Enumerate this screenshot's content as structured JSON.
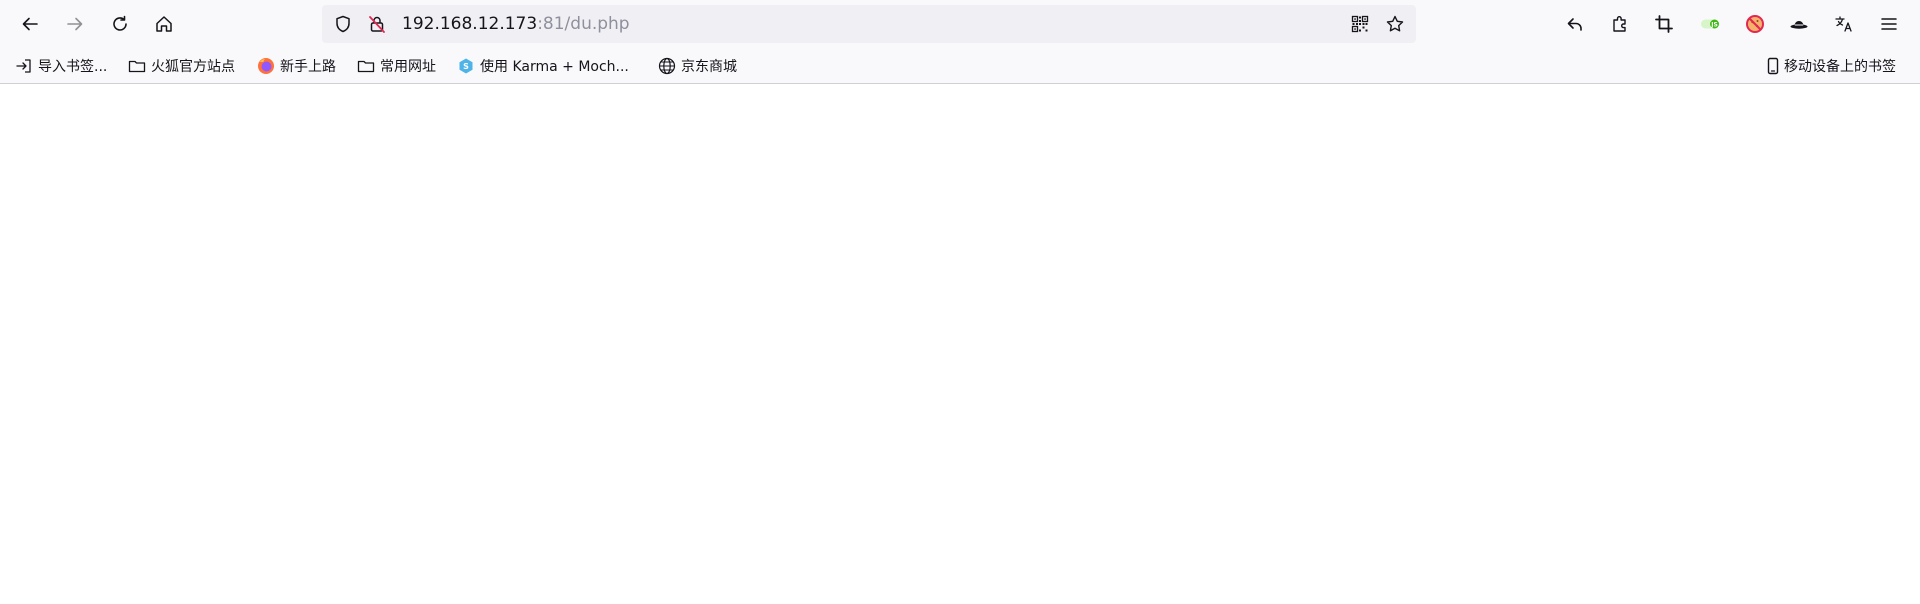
{
  "toolbar": {
    "back_icon": "arrow-left-icon",
    "forward_icon": "arrow-right-icon",
    "reload_icon": "reload-icon",
    "home_icon": "home-icon"
  },
  "urlbar": {
    "host": "192.168.12.173",
    "rest": ":81/du.php",
    "icons": [
      "shield-icon",
      "insecure-lock-icon",
      "qr-code-icon",
      "star-icon"
    ]
  },
  "extensions": {
    "icons": [
      "undo-icon",
      "extensions-puzzle-icon",
      "crop-icon",
      "js-toggle-icon",
      "no-cookie-icon",
      "hat-icon",
      "translate-icon",
      "hamburger-menu-icon"
    ]
  },
  "bookmarks": {
    "items": [
      {
        "label": "导入书签...",
        "icon": "import-icon"
      },
      {
        "label": "火狐官方站点",
        "icon": "folder-icon"
      },
      {
        "label": "新手上路",
        "icon": "firefox-icon"
      },
      {
        "label": "常用网址",
        "icon": "folder-icon"
      },
      {
        "label": "使用 Karma + Moch...",
        "icon": "karma-icon"
      },
      {
        "label": "京东商城",
        "icon": "globe-icon"
      }
    ],
    "mobile": {
      "label": "移动设备上的书签",
      "icon": "mobile-icon"
    }
  },
  "colors": {
    "toolbar_bg": "#f9f9fb",
    "urlbar_bg": "#f0f0f4",
    "url_dim": "#8f8f9d",
    "insecure_red": "#e22850"
  }
}
